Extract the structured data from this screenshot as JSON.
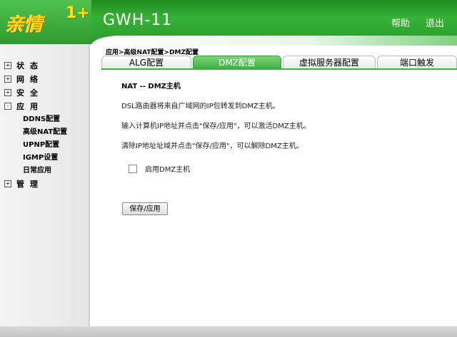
{
  "header": {
    "logo_text": "亲情",
    "logo_plus": "1+",
    "device_title": "GWH-11",
    "help_label": "帮助",
    "logout_label": "退出"
  },
  "sidebar": {
    "items": [
      {
        "box": "+",
        "label": "状态"
      },
      {
        "box": "+",
        "label": "网络"
      },
      {
        "box": "+",
        "label": "安全"
      },
      {
        "box": "-",
        "label": "应用"
      },
      {
        "box": "+",
        "label": "管理"
      }
    ],
    "sub_items": [
      "DDNS配置",
      "高级NAT配置",
      "UPNP配置",
      "IGMP设置",
      "日常应用"
    ]
  },
  "breadcrumb": "应用>高级NAT配置>DMZ配置",
  "tabs": [
    "ALG配置",
    "DMZ配置",
    "虚拟服务器配置",
    "端口触发"
  ],
  "active_tab_index": 1,
  "content": {
    "title": "NAT -- DMZ主机",
    "paragraphs": [
      "DSL路由器将来自广域网的IP包转发到DMZ主机。",
      "输入计算机IP地址并点击\"保存/应用\"，可以激活DMZ主机。",
      "清除IP地址址域并点击\"保存/应用\"，可以解除DMZ主机。"
    ],
    "checkbox_label": "启用DMZ主机",
    "checkbox_checked": false,
    "save_button_label": "保存/应用"
  },
  "colors": {
    "brand_green": "#2a9d2a",
    "active_tab": "#3eae3e",
    "logo_yellow": "#ffd400"
  }
}
